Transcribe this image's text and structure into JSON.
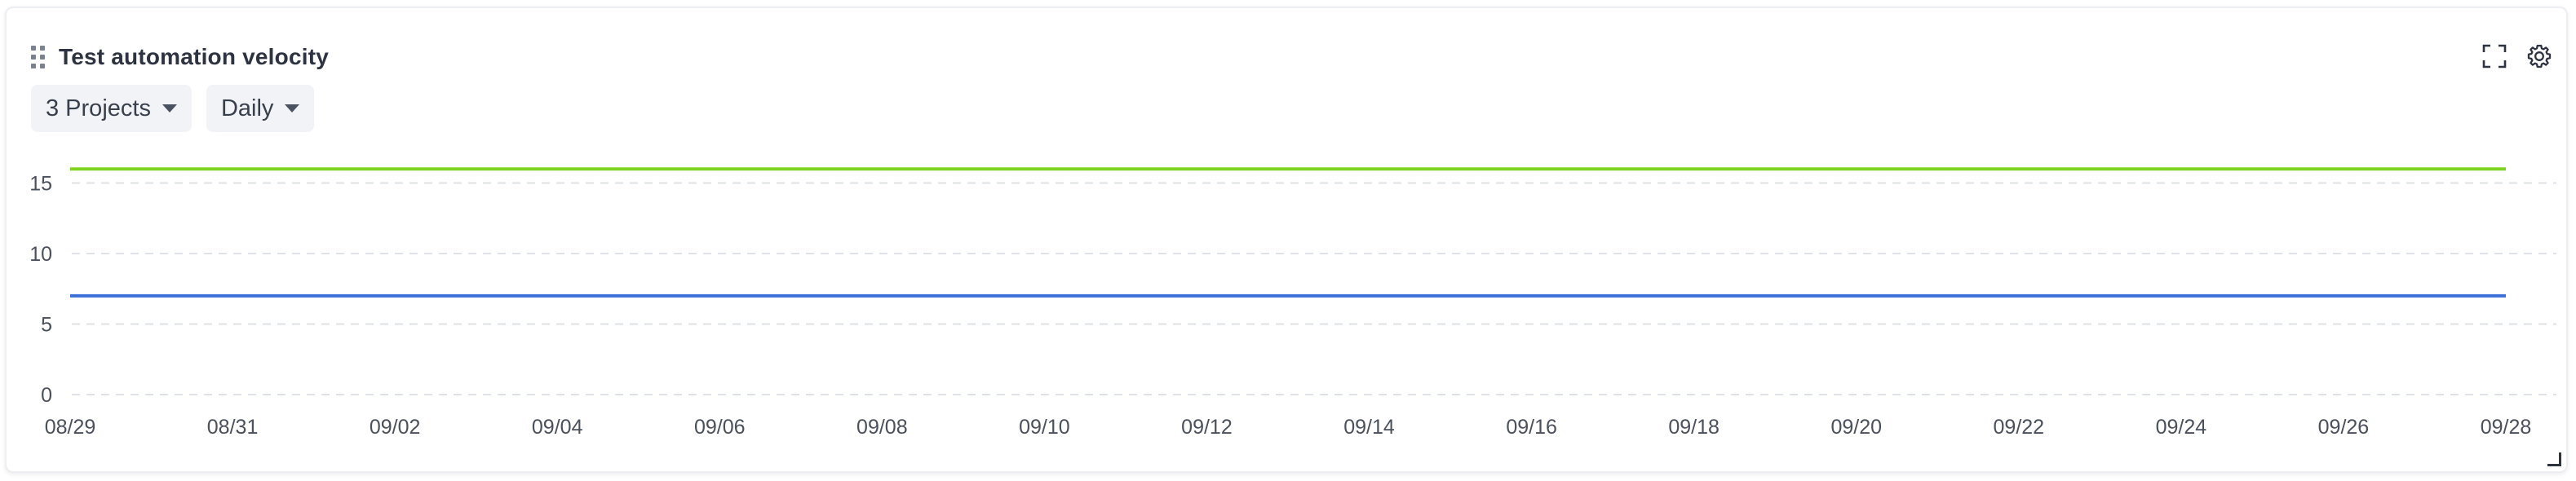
{
  "widget": {
    "title": "Test automation velocity",
    "filters": {
      "projects_label": "3 Projects",
      "interval_label": "Daily"
    },
    "icons": {
      "drag": "drag-handle-icon",
      "expand": "expand-icon",
      "settings": "gear-icon",
      "resize": "resize-handle-icon"
    }
  },
  "chart_data": {
    "type": "line",
    "title": "",
    "xlabel": "",
    "ylabel": "",
    "x_ticks": [
      "08/29",
      "08/31",
      "09/02",
      "09/04",
      "09/06",
      "09/08",
      "09/10",
      "09/12",
      "09/14",
      "09/16",
      "09/18",
      "09/20",
      "09/22",
      "09/24",
      "09/26",
      "09/28"
    ],
    "y_ticks": [
      0,
      5,
      10,
      15
    ],
    "ylim": [
      0,
      17.5
    ],
    "grid": true,
    "series": [
      {
        "color": "#7ed321",
        "values": [
          16,
          16,
          16,
          16,
          16,
          16,
          16,
          16,
          16,
          16,
          16,
          16,
          16,
          16,
          16,
          16
        ]
      },
      {
        "color": "#3b6fd8",
        "values": [
          7,
          7,
          7,
          7,
          7,
          7,
          7,
          7,
          7,
          7,
          7,
          7,
          7,
          7,
          7,
          7
        ]
      }
    ]
  }
}
